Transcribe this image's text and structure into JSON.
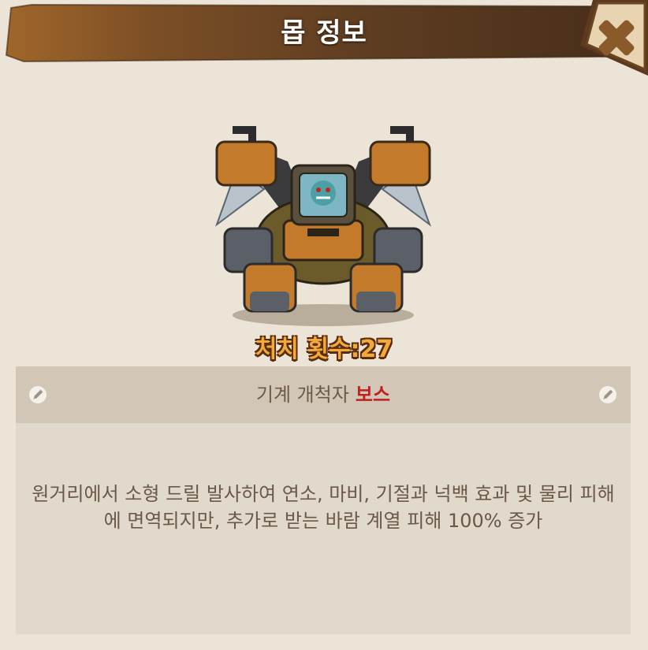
{
  "header": {
    "title": "몹 정보",
    "close_icon": "close-x-icon"
  },
  "monster": {
    "image": "drill-mech-boss-portrait",
    "kill_count_label": "처치 횟수:27"
  },
  "info": {
    "name": "기계 개척자",
    "tag": "보스",
    "left_icon": "pencil-icon",
    "right_icon": "pencil-icon",
    "description": "원거리에서 소형 드릴 발사하여 연소, 마비, 기절과 넉백 효과 및 물리 피해에 면역되지만, 추가로 받는 바람 계열 피해 100% 증가"
  },
  "colors": {
    "background": "#ece4d6",
    "banner": "#8a5a2b",
    "boss_tag": "#c11e1e",
    "kill_count": "#f3a93a"
  }
}
